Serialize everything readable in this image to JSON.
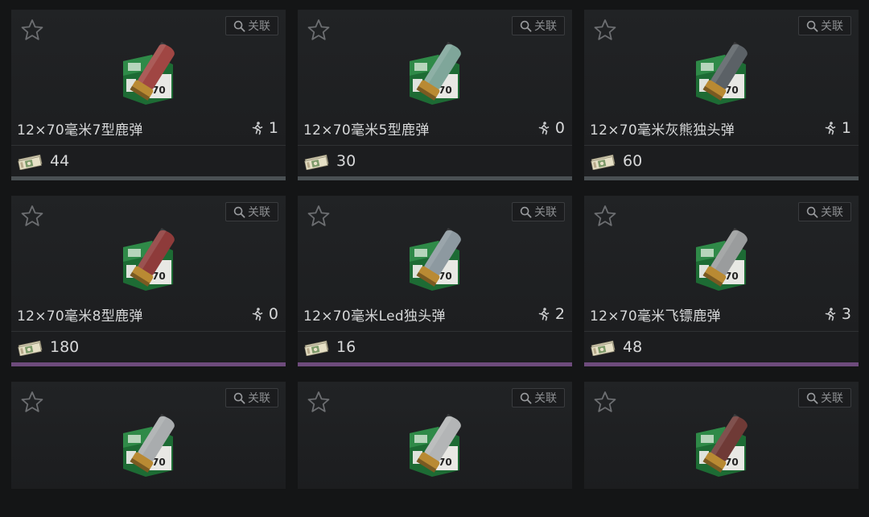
{
  "link_label": "关联",
  "colors": {
    "rarity_gray": "#4a5053",
    "rarity_purple": "#6e4b7c"
  },
  "items": [
    {
      "name": "12×70毫米7型鹿弹",
      "qty": "1",
      "price": "44",
      "rarity": "gray",
      "shell": "#a04643"
    },
    {
      "name": "12×70毫米5型鹿弹",
      "qty": "0",
      "price": "30",
      "rarity": "gray",
      "shell": "#7fa69a"
    },
    {
      "name": "12×70毫米灰熊独头弹",
      "qty": "1",
      "price": "60",
      "rarity": "gray",
      "shell": "#5b6166"
    },
    {
      "name": "12×70毫米8型鹿弹",
      "qty": "0",
      "price": "180",
      "rarity": "purple",
      "shell": "#8e3b3a"
    },
    {
      "name": "12×70毫米Led独头弹",
      "qty": "2",
      "price": "16",
      "rarity": "purple",
      "shell": "#8d99a0"
    },
    {
      "name": "12×70毫米飞镖鹿弹",
      "qty": "3",
      "price": "48",
      "rarity": "purple",
      "shell": "#9a9c9d"
    },
    {
      "name": "",
      "qty": "",
      "price": "",
      "rarity": "none",
      "shell": "#a9acae"
    },
    {
      "name": "",
      "qty": "",
      "price": "",
      "rarity": "none",
      "shell": "#b3b5b6"
    },
    {
      "name": "",
      "qty": "",
      "price": "",
      "rarity": "none",
      "shell": "#6f3a36"
    }
  ]
}
